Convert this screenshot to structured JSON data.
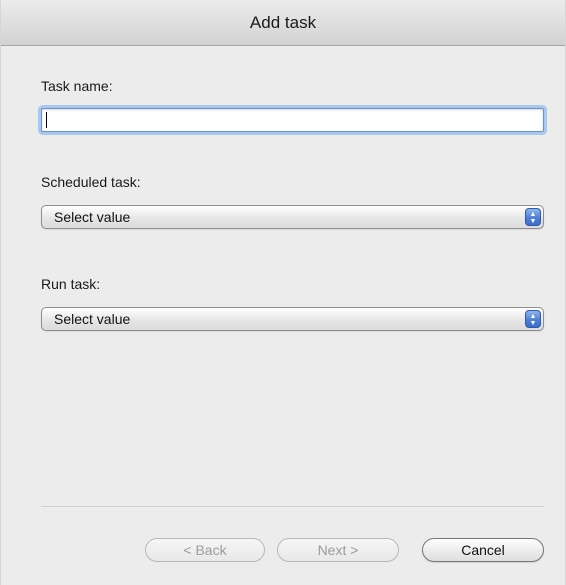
{
  "window": {
    "title": "Add task"
  },
  "form": {
    "task_name_label": "Task name:",
    "task_name_value": "",
    "scheduled_task_label": "Scheduled task:",
    "scheduled_task_value": "Select value",
    "run_task_label": "Run task:",
    "run_task_value": "Select value"
  },
  "buttons": {
    "back_label": "< Back",
    "next_label": "Next >",
    "cancel_label": "Cancel"
  },
  "icons": {
    "stepper": "up-down-chevron-icon"
  },
  "colors": {
    "window_bg": "#ececec",
    "focus_ring": "#a9c8f0",
    "stepper_blue": "#4f80d6"
  }
}
